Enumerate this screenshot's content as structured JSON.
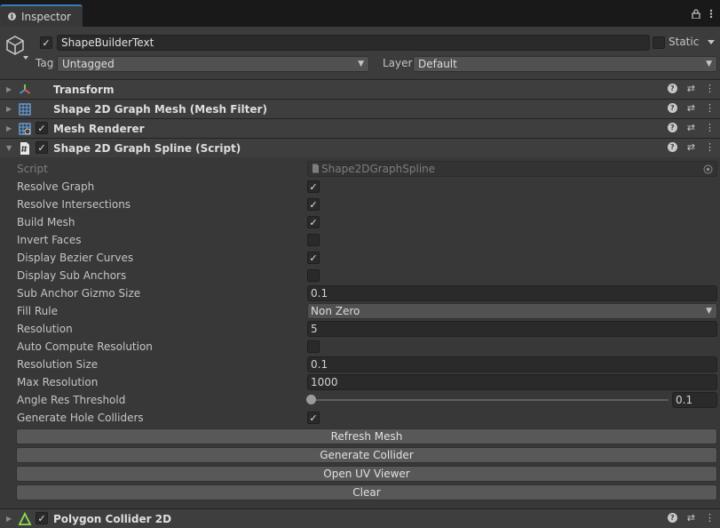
{
  "tab": {
    "title": "Inspector"
  },
  "header": {
    "object_name": "ShapeBuilderText",
    "static_label": "Static",
    "tag_label": "Tag",
    "tag_value": "Untagged",
    "layer_label": "Layer",
    "layer_value": "Default"
  },
  "components": [
    {
      "title": "Transform"
    },
    {
      "title": "Shape 2D Graph Mesh (Mesh Filter)"
    },
    {
      "title": "Mesh Renderer"
    },
    {
      "title": "Shape 2D Graph Spline (Script)"
    },
    {
      "title": "Polygon Collider 2D"
    }
  ],
  "script_props": {
    "script_label": "Script",
    "script_value": "Shape2DGraphSpline",
    "resolve_graph": "Resolve Graph",
    "resolve_intersections": "Resolve Intersections",
    "build_mesh": "Build Mesh",
    "invert_faces": "Invert Faces",
    "display_bezier": "Display Bezier Curves",
    "display_sub_anchors": "Display Sub Anchors",
    "sub_anchor_gizmo_label": "Sub Anchor Gizmo Size",
    "sub_anchor_gizmo_value": "0.1",
    "fill_rule_label": "Fill Rule",
    "fill_rule_value": "Non Zero",
    "resolution_label": "Resolution",
    "resolution_value": "5",
    "auto_compute": "Auto Compute Resolution",
    "resolution_size_label": "Resolution Size",
    "resolution_size_value": "0.1",
    "max_resolution_label": "Max Resolution",
    "max_resolution_value": "1000",
    "angle_res_label": "Angle Res Threshold",
    "angle_res_value": "0.1",
    "gen_hole_colliders": "Generate Hole Colliders"
  },
  "buttons": {
    "refresh_mesh": "Refresh Mesh",
    "generate_collider": "Generate Collider",
    "open_uv_viewer": "Open UV Viewer",
    "clear": "Clear"
  },
  "glyphs": {
    "check": "✓",
    "arrow": "▼",
    "fold_closed": "▶",
    "fold_open": "▼",
    "help": "?",
    "preset": "⇄",
    "menu": "⋮"
  },
  "colors": {
    "tab_accent": "#3a79bb",
    "panel_bg": "#383838",
    "header_bg": "#3e3e3e"
  }
}
